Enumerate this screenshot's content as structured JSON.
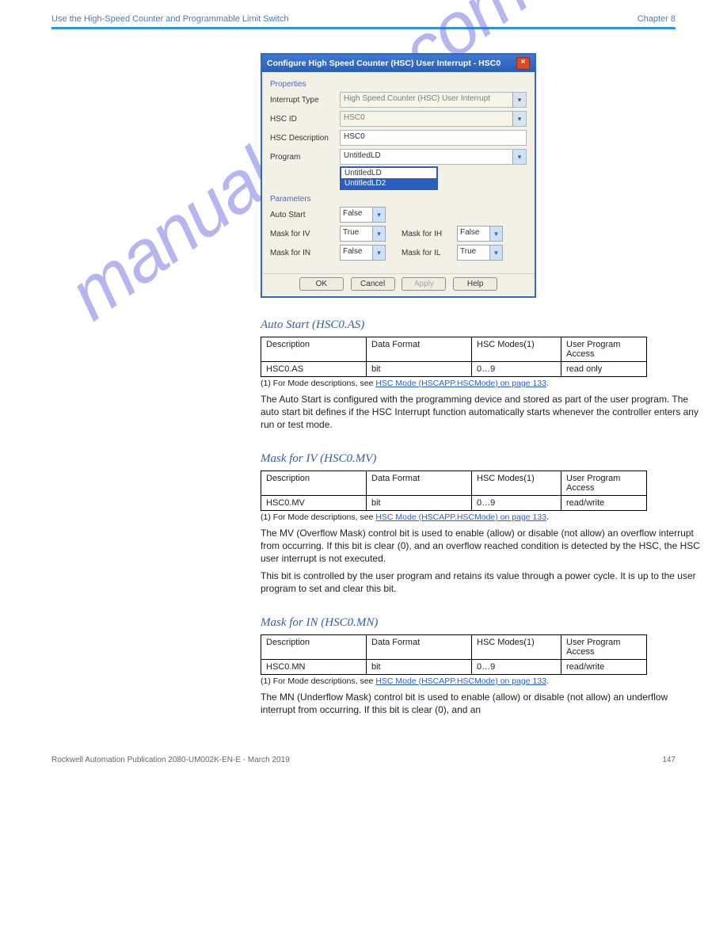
{
  "header": {
    "left": "Use the High-Speed Counter and Programmable Limit Switch",
    "right": "Chapter 8"
  },
  "dialog": {
    "title": "Configure High Speed Counter (HSC) User Interrupt - HSC0",
    "properties_label": "Properties",
    "interrupt_type_label": "Interrupt Type",
    "interrupt_type_value": "High Speed Counter (HSC) User Interrupt",
    "hsc_id_label": "HSC ID",
    "hsc_id_value": "HSC0",
    "hsc_desc_label": "HSC Description",
    "hsc_desc_value": "HSC0",
    "program_label": "Program",
    "program_value": "UntitledLD",
    "program_opt1": "UntitledLD",
    "program_opt2": "UntitledLD2",
    "parameters_label": "Parameters",
    "auto_start_label": "Auto Start",
    "auto_start_value": "False",
    "mask_iv_label": "Mask for IV",
    "mask_iv_value": "True",
    "mask_in_label": "Mask for IN",
    "mask_in_value": "False",
    "mask_ih_label": "Mask for IH",
    "mask_ih_value": "False",
    "mask_il_label": "Mask for IL",
    "mask_il_value": "True",
    "ok": "OK",
    "cancel": "Cancel",
    "apply": "Apply",
    "help": "Help"
  },
  "sections": {
    "as": {
      "title": "Auto Start (HSC0.AS)",
      "tbl_h1": "Description",
      "tbl_h2": "Data Format",
      "tbl_h3": "HSC Modes(1)",
      "tbl_h4": "User Program Access",
      "tbl_r1": "HSC0.AS",
      "tbl_r2": "bit",
      "tbl_r3": "0…9",
      "tbl_r4": "read only",
      "foot": "(1) For Mode descriptions, see ",
      "foot_link": "HSC Mode (HSCAPP.HSCMode) on page 133",
      "foot2": ".",
      "p1": "The Auto Start is configured with the programming device and stored as part of the user program. The auto start bit defines if the HSC Interrupt function automatically starts whenever the controller enters any run or test mode."
    },
    "mv": {
      "title": "Mask for IV (HSC0.MV)",
      "tbl_h1": "Description",
      "tbl_h2": "Data Format",
      "tbl_h3": "HSC Modes(1)",
      "tbl_h4": "User Program Access",
      "tbl_r1": "HSC0.MV",
      "tbl_r2": "bit",
      "tbl_r3": "0…9",
      "tbl_r4": "read/write",
      "foot": "(1) For Mode descriptions, see ",
      "foot_link": "HSC Mode (HSCAPP.HSCMode) on page 133",
      "foot2": ".",
      "p1": "The MV (Overflow Mask) control bit is used to enable (allow) or disable (not allow) an overflow interrupt from occurring. If this bit is clear (0), and an overflow reached condition is detected by the HSC, the HSC user interrupt is not executed.",
      "p2": "This bit is controlled by the user program and retains its value through a power cycle. It is up to the user program to set and clear this bit."
    },
    "mn": {
      "title": "Mask for IN (HSC0.MN)",
      "tbl_h1": "Description",
      "tbl_h2": "Data Format",
      "tbl_h3": "HSC Modes(1)",
      "tbl_h4": "User Program Access",
      "tbl_r1": "HSC0.MN",
      "tbl_r2": "bit",
      "tbl_r3": "0…9",
      "tbl_r4": "read/write",
      "foot": "(1) For Mode descriptions, see ",
      "foot_link": "HSC Mode (HSCAPP.HSCMode) on page 133",
      "foot2": ".",
      "p1": "The MN (Underflow Mask) control bit is used to enable (allow) or disable (not allow) an underflow interrupt from occurring. If this bit is clear (0), and an"
    }
  },
  "footer": {
    "left": "Rockwell Automation Publication 2080-UM002K-EN-E - March 2019",
    "right": "147"
  },
  "watermark": "manualshive.com"
}
